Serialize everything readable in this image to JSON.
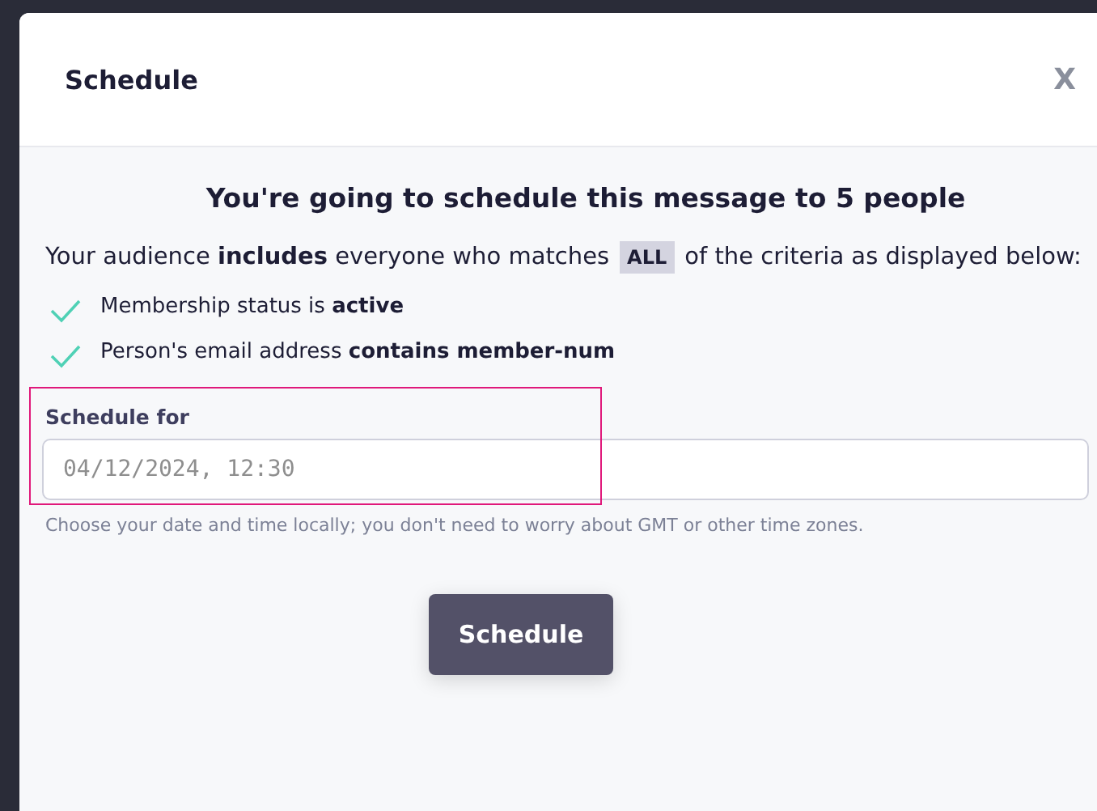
{
  "dialog": {
    "title": "Schedule",
    "close": "X"
  },
  "heading": "You're going to schedule this message to 5 people",
  "audience": {
    "before": "Your audience **includes** everyone who matches",
    "match": "ALL",
    "after": "of the criteria as displayed below:"
  },
  "criteria": [
    {
      "text": "Membership status is **active**",
      "checked": true
    },
    {
      "text": "Person's email address **contains member-num**",
      "checked": true
    }
  ],
  "schedule_for": {
    "label": "Schedule for",
    "value": "04/12/2024, 12:30",
    "highlighted": true,
    "hint": "Choose your date and time locally; you don't need to worry about GMT or other time zones."
  },
  "buttons": [
    {
      "label": "Schedule"
    }
  ]
}
